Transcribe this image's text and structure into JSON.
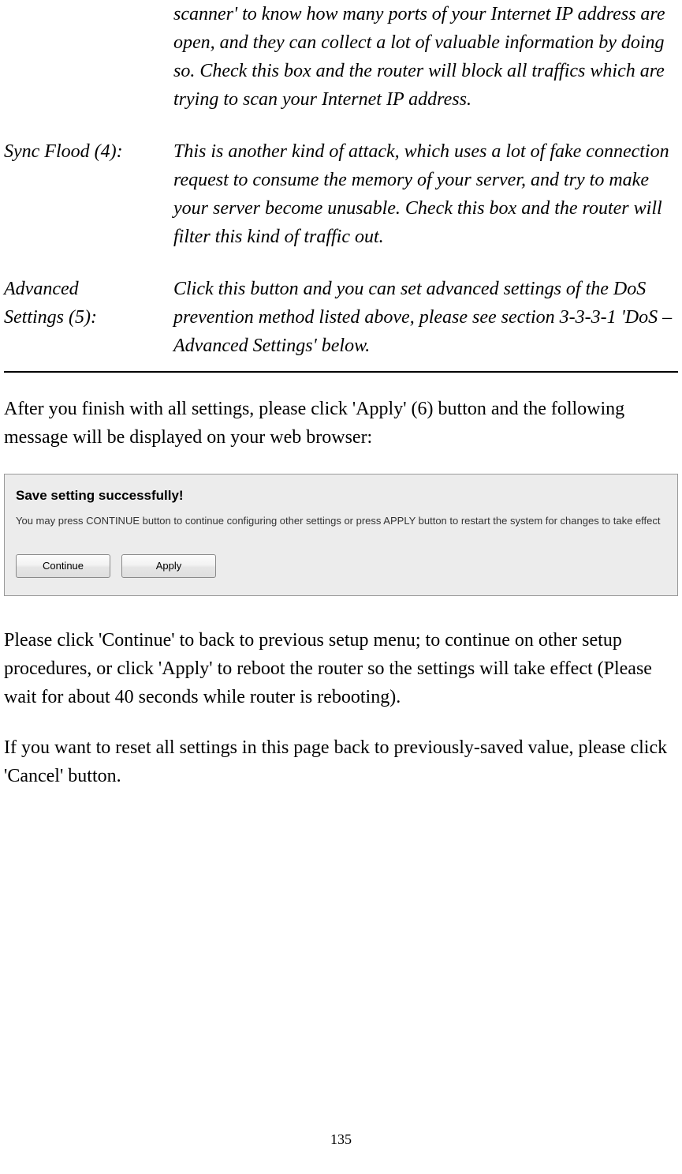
{
  "definitions": [
    {
      "label": "",
      "desc": "scanner' to know how many ports of your Internet IP address are open, and they can collect a lot of valuable information by doing so. Check this box and the router will block all traffics which are trying to scan your Internet IP address."
    },
    {
      "label": "Sync Flood (4):",
      "desc": "This is another kind of attack, which uses a lot of fake connection request to consume the memory of your server, and try to make your server become unusable. Check this box and the router will filter this kind of traffic out."
    },
    {
      "label_line1": "Advanced",
      "label_line2": "Settings (5):",
      "desc": "Click this button and you can set advanced settings of the DoS prevention method listed above, please see section 3-3-3-1 'DoS – Advanced Settings' below."
    }
  ],
  "para1": "After you finish with all settings, please click 'Apply' (6) button and the following message will be displayed on your web browser:",
  "screenshot": {
    "title": "Save setting successfully!",
    "text": "You may press CONTINUE button to continue configuring other settings or press APPLY button to restart the system for changes to take effect",
    "continue_label": "Continue",
    "apply_label": "Apply"
  },
  "para2": "Please click 'Continue' to back to previous setup menu; to continue on other setup procedures, or click 'Apply' to reboot the router so the settings will take effect (Please wait for about 40 seconds while router is rebooting).",
  "para3": "If you want to reset all settings in this page back to previously-saved value, please click 'Cancel' button.",
  "page_number": "135"
}
